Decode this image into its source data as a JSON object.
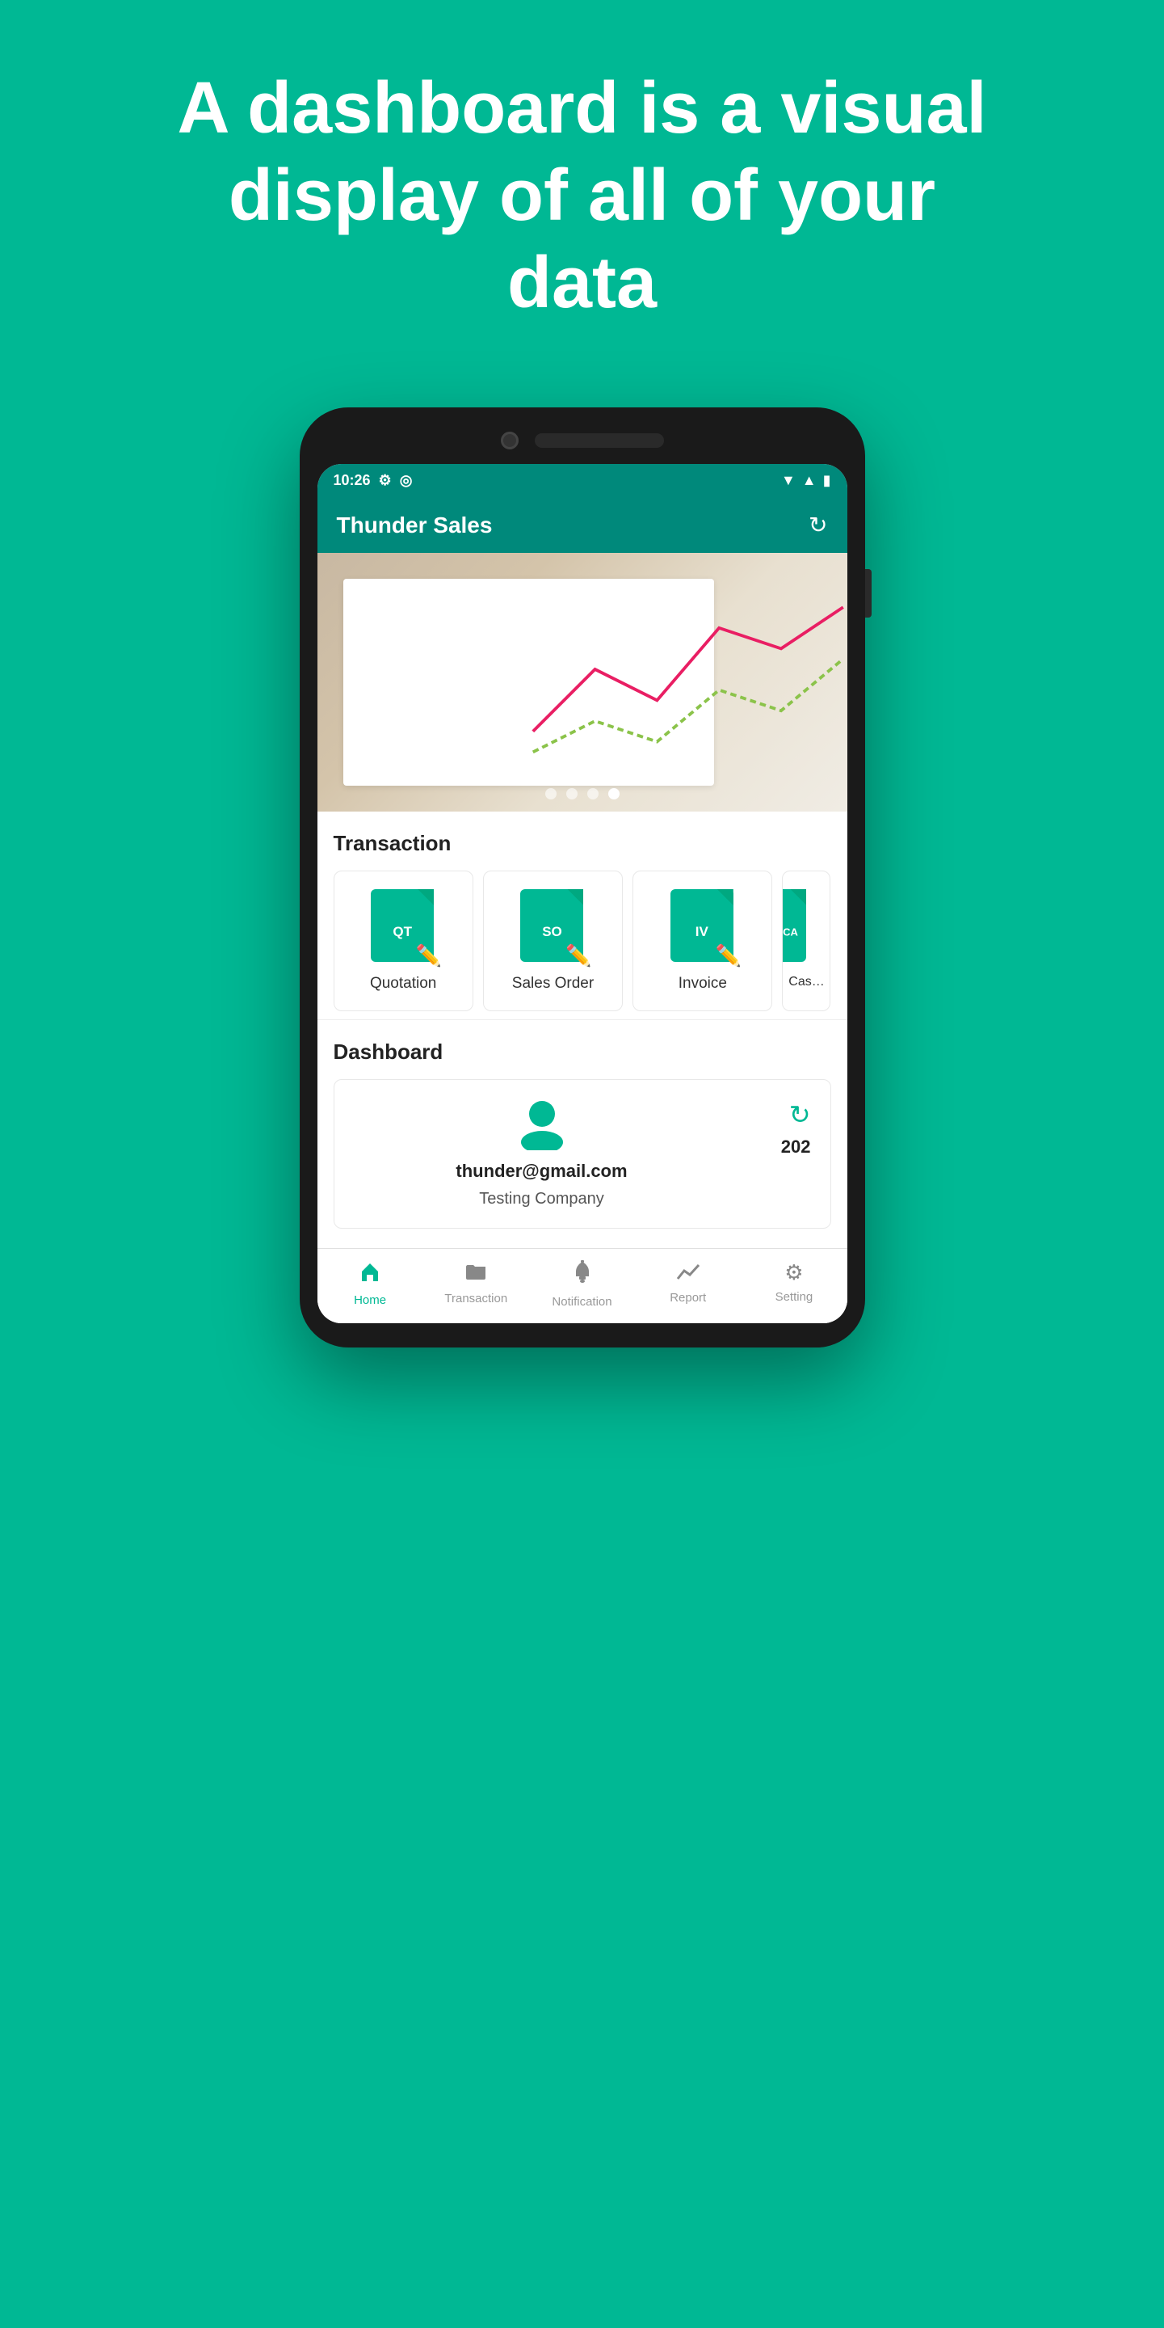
{
  "hero": {
    "title": "A dashboard is a visual display of all of your data"
  },
  "statusBar": {
    "time": "10:26",
    "icons": [
      "gear",
      "circle",
      "wifi",
      "signal",
      "battery"
    ]
  },
  "appBar": {
    "title": "Thunder Sales",
    "refreshIcon": "↻"
  },
  "carousel": {
    "dots": [
      {
        "active": false
      },
      {
        "active": false
      },
      {
        "active": false
      },
      {
        "active": true
      }
    ]
  },
  "transactionSection": {
    "title": "Transaction",
    "items": [
      {
        "code": "QT",
        "label": "Quotation"
      },
      {
        "code": "SO",
        "label": "Sales Order"
      },
      {
        "code": "IV",
        "label": "Invoice"
      },
      {
        "code": "CA",
        "label": "Cash"
      }
    ]
  },
  "dashboardSection": {
    "title": "Dashboard",
    "card": {
      "email": "thunder@gmail.com",
      "company": "Testing Company",
      "year": "202",
      "syncIcon": "↻"
    }
  },
  "bottomNav": {
    "items": [
      {
        "label": "Home",
        "icon": "🏠",
        "active": true
      },
      {
        "label": "Transaction",
        "icon": "📁",
        "active": false
      },
      {
        "label": "Notification",
        "icon": "🔔",
        "active": false
      },
      {
        "label": "Report",
        "icon": "📈",
        "active": false
      },
      {
        "label": "Setting",
        "icon": "⚙",
        "active": false
      }
    ]
  }
}
